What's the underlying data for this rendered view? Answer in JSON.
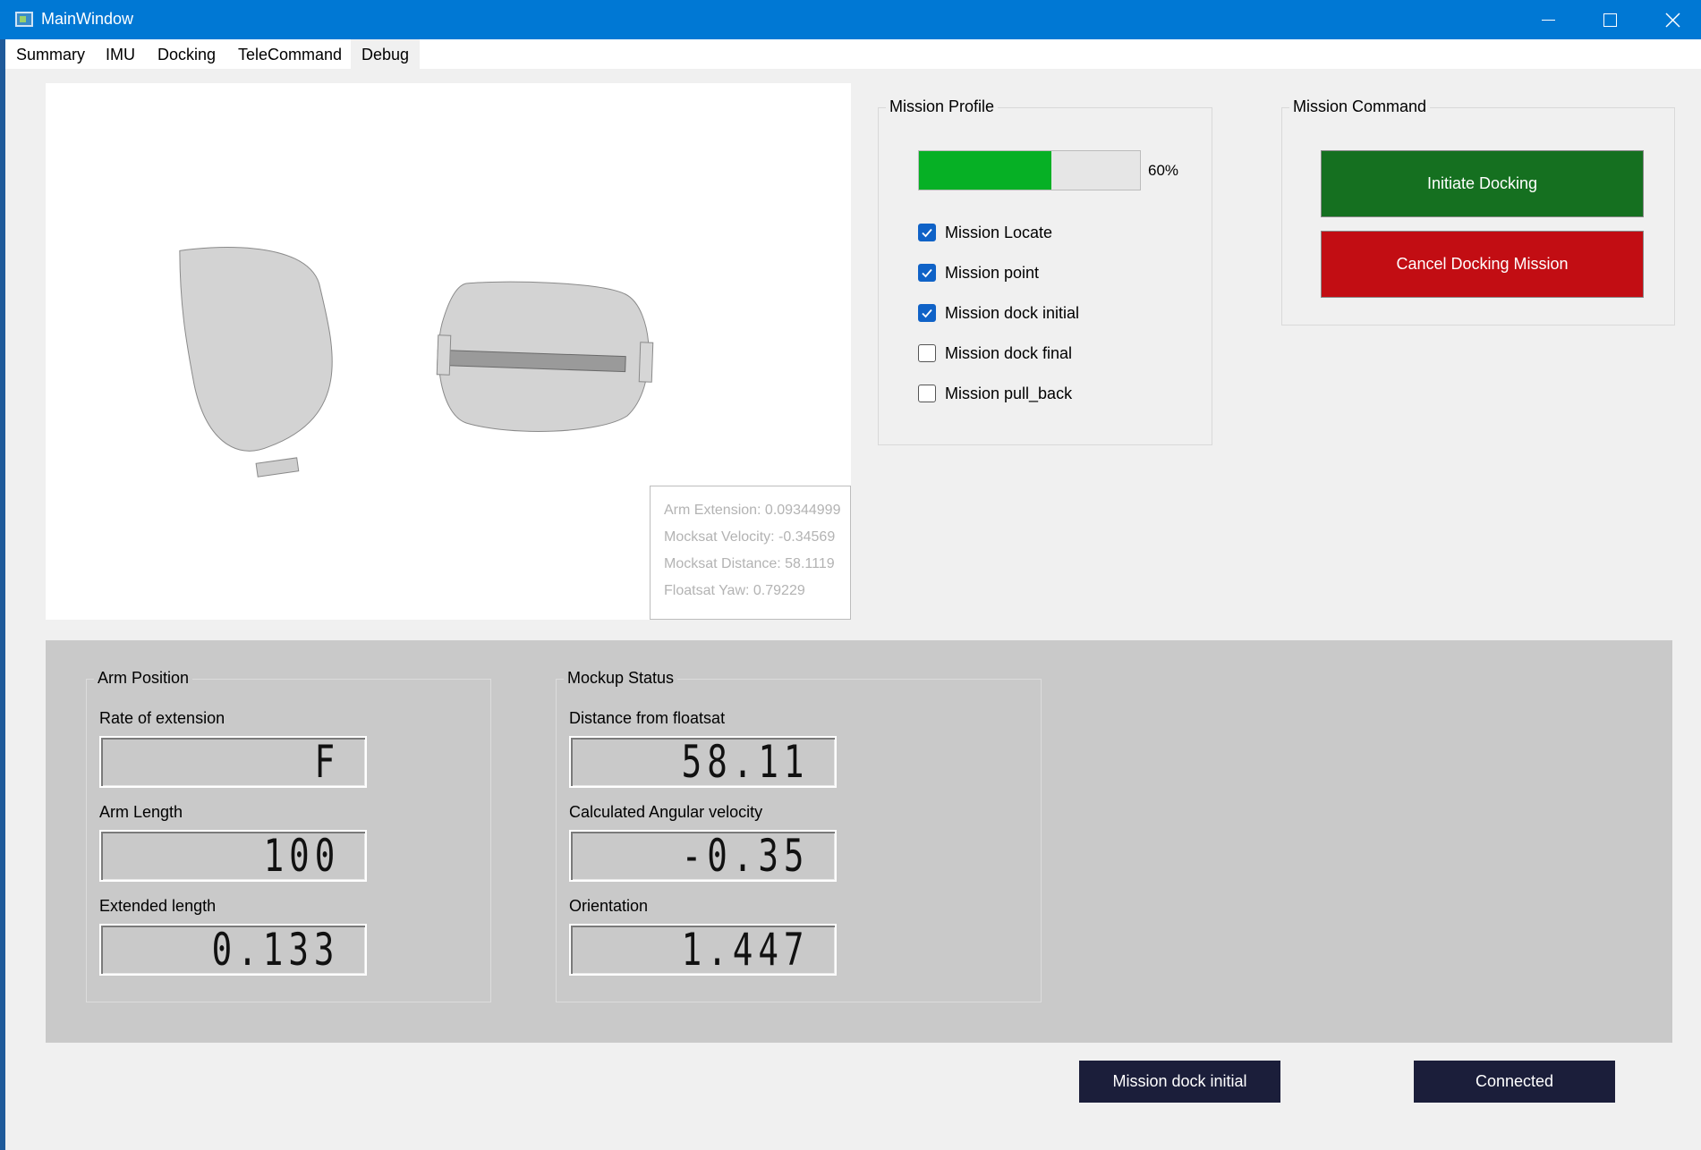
{
  "window": {
    "title": "MainWindow"
  },
  "menu": {
    "items": [
      "Summary",
      "IMU",
      "Docking",
      "TeleCommand",
      "Debug"
    ]
  },
  "overlay": {
    "lines": [
      "Arm Extension: 0.09344999",
      "Mocksat Velocity: -0.34569",
      "Mocksat Distance: 58.1119",
      "Floatsat Yaw: 0.79229"
    ]
  },
  "mission_profile": {
    "title": "Mission Profile",
    "progress_percent": 60,
    "progress_label": "60%",
    "progress_color": "#06b025",
    "steps": [
      {
        "label": "Mission Locate",
        "checked": true
      },
      {
        "label": "Mission point",
        "checked": true
      },
      {
        "label": "Mission dock initial",
        "checked": true
      },
      {
        "label": "Mission dock final",
        "checked": false
      },
      {
        "label": "Mission pull_back",
        "checked": false
      }
    ]
  },
  "mission_command": {
    "title": "Mission Command",
    "initiate_label": "Initiate Docking",
    "cancel_label": "Cancel Docking Mission"
  },
  "arm_position": {
    "title": "Arm Position",
    "rate_label": "Rate of extension",
    "rate_value": "F",
    "arm_length_label": "Arm Length",
    "arm_length_value": "100",
    "extended_label": "Extended length",
    "extended_value": "0.133"
  },
  "mockup_status": {
    "title": "Mockup Status",
    "distance_label": "Distance from floatsat",
    "distance_value": "58.11",
    "angular_label": "Calculated Angular velocity",
    "angular_value": "-0.35",
    "orientation_label": "Orientation",
    "orientation_value": "1.447"
  },
  "status": {
    "mission_state": "Mission dock initial",
    "connection": "Connected"
  }
}
